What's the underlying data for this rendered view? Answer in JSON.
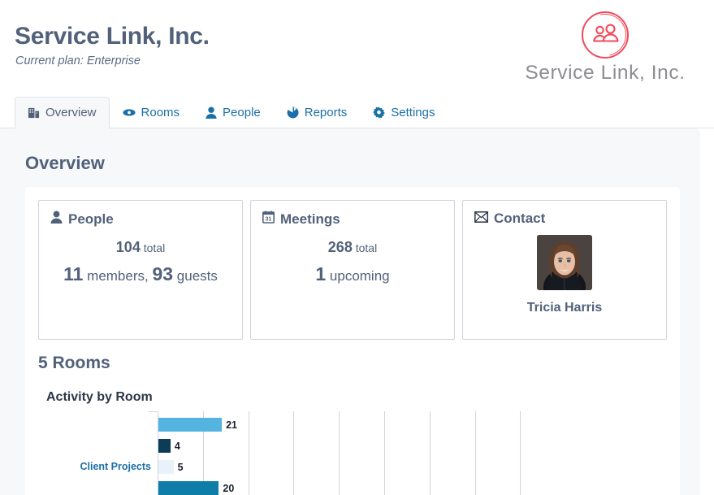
{
  "header": {
    "org_title": "Service Link, Inc.",
    "plan_label": "Current plan: Enterprise",
    "logo_wordmark": "Service Link, Inc.",
    "logo_icon": "people-circle-logo",
    "logo_color": "#f04a5a"
  },
  "tabs": [
    {
      "label": "Overview",
      "icon": "building-icon",
      "active": true
    },
    {
      "label": "Rooms",
      "icon": "room-icon",
      "active": false
    },
    {
      "label": "People",
      "icon": "person-icon",
      "active": false
    },
    {
      "label": "Reports",
      "icon": "pie-chart-icon",
      "active": false
    },
    {
      "label": "Settings",
      "icon": "gear-icon",
      "active": false
    }
  ],
  "page": {
    "title": "Overview"
  },
  "cards": {
    "people": {
      "title": "People",
      "icon": "person-icon",
      "total_value": "104",
      "total_label": "total",
      "members_value": "11",
      "members_label": "members,",
      "guests_value": "93",
      "guests_label": "guests"
    },
    "meetings": {
      "title": "Meetings",
      "icon": "calendar-icon",
      "total_value": "268",
      "total_label": "total",
      "upcoming_value": "1",
      "upcoming_label": "upcoming"
    },
    "contact": {
      "title": "Contact",
      "icon": "envelope-icon",
      "person_name": "Tricia Harris"
    }
  },
  "rooms": {
    "heading": "5 Rooms"
  },
  "chart_data": {
    "type": "bar",
    "orientation": "horizontal",
    "title": "Activity by Room",
    "xlabel": "",
    "ylabel": "",
    "categories": [
      "Client Projects"
    ],
    "series": [
      {
        "name": "series-1",
        "values": [
          21
        ],
        "color": "#55b4df"
      },
      {
        "name": "series-2",
        "values": [
          4
        ],
        "color": "#0d3c56"
      },
      {
        "name": "series-3",
        "values": [
          5
        ],
        "color": "#e9f1fa"
      },
      {
        "name": "series-4",
        "values": [
          20
        ],
        "color": "#0e7ea8"
      }
    ],
    "bar_labels": [
      "21",
      "4",
      "5",
      "20"
    ],
    "xlim": [
      0,
      120
    ],
    "gridlines": [
      15,
      30,
      45,
      60,
      75,
      90,
      105,
      120
    ],
    "grid": true,
    "legend": "none"
  }
}
